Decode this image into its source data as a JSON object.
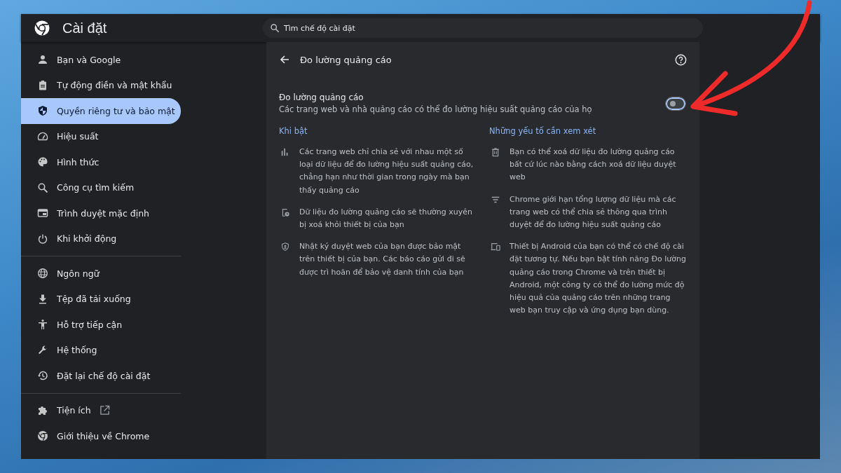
{
  "window": {
    "title": "Cài đặt"
  },
  "search": {
    "placeholder": "Tìm chế độ cài đặt"
  },
  "sidebar": {
    "groups": [
      {
        "items": [
          {
            "label": "Bạn và Google",
            "selected": false,
            "opens_externally": false
          },
          {
            "label": "Tự động điền và mật khẩu",
            "selected": false,
            "opens_externally": false
          },
          {
            "label": "Quyền riêng tư và bảo mật",
            "selected": true,
            "opens_externally": false
          },
          {
            "label": "Hiệu suất",
            "selected": false,
            "opens_externally": false
          },
          {
            "label": "Hình thức",
            "selected": false,
            "opens_externally": false
          },
          {
            "label": "Công cụ tìm kiếm",
            "selected": false,
            "opens_externally": false
          },
          {
            "label": "Trình duyệt mặc định",
            "selected": false,
            "opens_externally": false
          },
          {
            "label": "Khi khởi động",
            "selected": false,
            "opens_externally": false
          }
        ]
      },
      {
        "items": [
          {
            "label": "Ngôn ngữ",
            "selected": false,
            "opens_externally": false
          },
          {
            "label": "Tệp đã tải xuống",
            "selected": false,
            "opens_externally": false
          },
          {
            "label": "Hỗ trợ tiếp cận",
            "selected": false,
            "opens_externally": false
          },
          {
            "label": "Hệ thống",
            "selected": false,
            "opens_externally": false
          },
          {
            "label": "Đặt lại chế độ cài đặt",
            "selected": false,
            "opens_externally": false
          }
        ]
      },
      {
        "items": [
          {
            "label": "Tiện ích",
            "selected": false,
            "opens_externally": true
          },
          {
            "label": "Giới thiệu về Chrome",
            "selected": false,
            "opens_externally": false
          }
        ]
      }
    ]
  },
  "page": {
    "title": "Đo lường quảng cáo",
    "setting": {
      "label": "Đo lường quảng cáo",
      "description": "Các trang web và nhà quảng cáo có thể đo lường hiệu suất quảng cáo của họ",
      "on": false
    },
    "columns": [
      {
        "heading": "Khi bật",
        "items": [
          "Các trang web chỉ chia sẻ với nhau một số loại dữ liệu để đo lường hiệu suất quảng cáo, chẳng hạn như thời gian trong ngày mà bạn thấy quảng cáo",
          "Dữ liệu đo lường quảng cáo sẽ thường xuyên bị xoá khỏi thiết bị của bạn",
          "Nhật ký duyệt web của bạn được bảo mật trên thiết bị của bạn. Các báo cáo gửi đi sẽ được trì hoãn để bảo vệ danh tính của bạn"
        ]
      },
      {
        "heading": "Những yếu tố cần xem xét",
        "items": [
          "Bạn có thể xoá dữ liệu đo lường quảng cáo bất cứ lúc nào bằng cách xoá dữ liệu duyệt web",
          "Chrome giới hạn tổng lượng dữ liệu mà các trang web có thể chia sẻ thông qua trình duyệt để đo lường hiệu suất quảng cáo",
          "Thiết bị Android của bạn có thể có chế độ cài đặt tương tự. Nếu bạn bật tính năng Đo lường quảng cáo trong Chrome và trên thiết bị Android, một công ty có thể đo lường mức độ hiệu quả của quảng cáo trên những trang web bạn truy cập và ứng dụng bạn dùng."
        ]
      }
    ]
  }
}
